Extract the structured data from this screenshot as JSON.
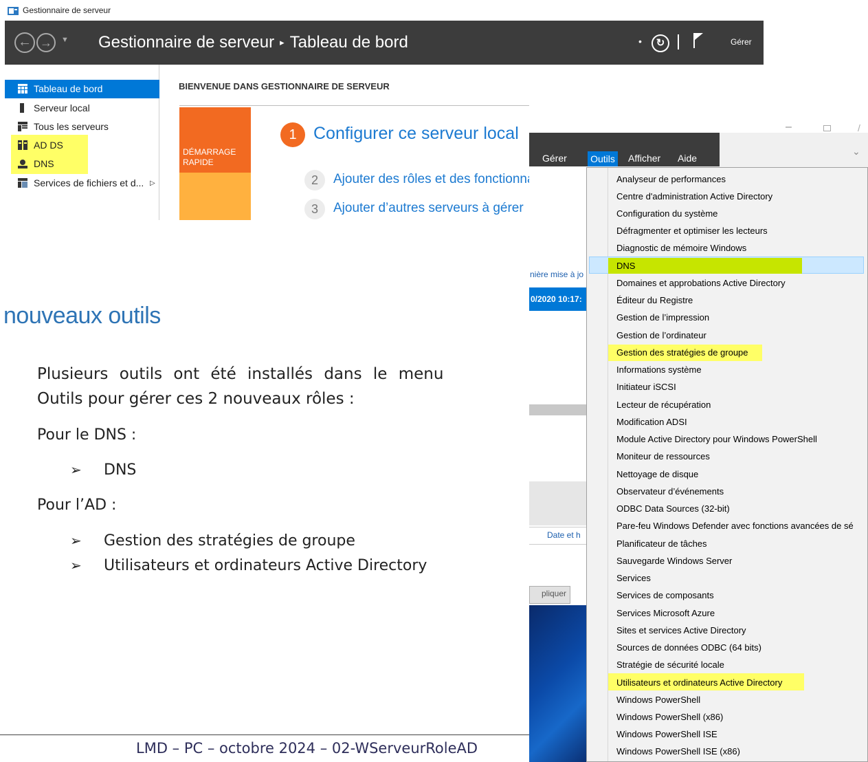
{
  "window": {
    "title": "Gestionnaire de serveur",
    "breadcrumb_root": "Gestionnaire de serveur",
    "breadcrumb_sep": "▸",
    "breadcrumb_page": "Tableau de bord",
    "manage_label": "Gérer"
  },
  "sidebar": {
    "items": [
      {
        "label": "Tableau de bord",
        "icon": "dashboard-icon",
        "selected": true
      },
      {
        "label": "Serveur local",
        "icon": "server-icon"
      },
      {
        "label": "Tous les serveurs",
        "icon": "servers-icon"
      },
      {
        "label": "AD DS",
        "icon": "adds-icon",
        "highlighted": true
      },
      {
        "label": "DNS",
        "icon": "dns-icon",
        "highlighted": true
      },
      {
        "label": "Services de fichiers et d...",
        "icon": "file-services-icon",
        "arrow": "▷"
      }
    ]
  },
  "main": {
    "welcome": "BIENVENUE DANS GESTIONNAIRE DE SERVEUR",
    "quickstart": "DÉMARRAGE RAPIDE",
    "steps": [
      {
        "num": "1",
        "label": "Configurer ce serveur local"
      },
      {
        "num": "2",
        "label": "Ajouter des rôles et des fonctionna"
      },
      {
        "num": "3",
        "label": "Ajouter d’autres serveurs à gérer"
      }
    ]
  },
  "doc": {
    "heading": "nouveaux outils",
    "para_line1": "Plusieurs outils ont été installés dans le menu",
    "para_line2": "Outils pour gérer ces 2 nouveaux rôles :",
    "dns_title": "Pour le DNS :",
    "dns_bullets": [
      "DNS"
    ],
    "ad_title": "Pour l’AD :",
    "ad_bullets": [
      "Gestion des stratégies de groupe",
      "Utilisateurs et ordinateurs Active Directory"
    ],
    "bullet_glyph": "➢",
    "footer": "LMD – PC – octobre 2024 – 02-WServeurRoleAD"
  },
  "overlay": {
    "menubar": [
      "Gérer",
      "Outils",
      "Afficher",
      "Aide"
    ],
    "bg_texts": {
      "last_update": "nière mise à jo",
      "datetime": "0/2020 10:17:",
      "date_header": "Date et h",
      "apply": "pliquer"
    },
    "menu_items": [
      {
        "label": "Analyseur de performances"
      },
      {
        "label": "Centre d'administration Active Directory"
      },
      {
        "label": "Configuration du système"
      },
      {
        "label": "Défragmenter et optimiser les lecteurs"
      },
      {
        "label": "Diagnostic de mémoire Windows"
      },
      {
        "label": "DNS",
        "state": "hover-highlighted"
      },
      {
        "label": "Domaines et approbations Active Directory"
      },
      {
        "label": "Éditeur du Registre"
      },
      {
        "label": "Gestion de l’impression"
      },
      {
        "label": "Gestion de l’ordinateur"
      },
      {
        "label": "Gestion des stratégies de groupe",
        "state": "highlighted"
      },
      {
        "label": "Informations système"
      },
      {
        "label": "Initiateur iSCSI"
      },
      {
        "label": "Lecteur de récupération"
      },
      {
        "label": "Modification ADSI"
      },
      {
        "label": "Module Active Directory pour Windows PowerShell"
      },
      {
        "label": "Moniteur de ressources"
      },
      {
        "label": "Nettoyage de disque"
      },
      {
        "label": "Observateur d’événements"
      },
      {
        "label": "ODBC Data Sources (32-bit)"
      },
      {
        "label": "Pare-feu Windows Defender avec fonctions avancées de sé"
      },
      {
        "label": "Planificateur de tâches"
      },
      {
        "label": "Sauvegarde Windows Server"
      },
      {
        "label": "Services"
      },
      {
        "label": "Services de composants"
      },
      {
        "label": "Services Microsoft Azure"
      },
      {
        "label": "Sites et services Active Directory"
      },
      {
        "label": "Sources de données ODBC (64 bits)"
      },
      {
        "label": "Stratégie de sécurité locale"
      },
      {
        "label": "Utilisateurs et ordinateurs Active Directory",
        "state": "highlighted"
      },
      {
        "label": "Windows PowerShell"
      },
      {
        "label": "Windows PowerShell (x86)"
      },
      {
        "label": "Windows PowerShell ISE"
      },
      {
        "label": "Windows PowerShell ISE (x86)"
      }
    ]
  },
  "colors": {
    "accent": "#0078d7",
    "titlebar_dark": "#3c3c3c",
    "quickstart_orange": "#f26a21",
    "highlight_yellow": "#ffff66",
    "dns_highlight": "#c6e500",
    "heading_blue": "#2e74b5"
  }
}
